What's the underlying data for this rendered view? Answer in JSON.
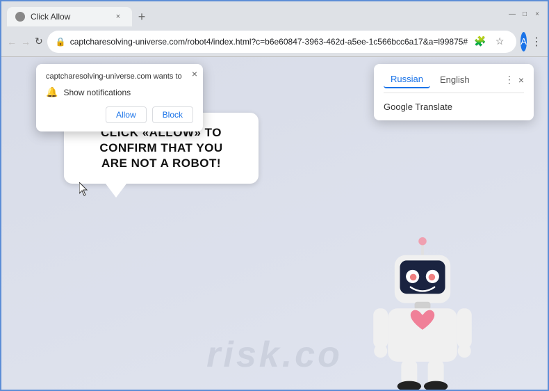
{
  "window": {
    "title": "Click Allow",
    "close_label": "×",
    "min_label": "—",
    "max_label": "□"
  },
  "tab": {
    "title": "Click Allow",
    "new_tab_icon": "+"
  },
  "address_bar": {
    "url": "captcharesolving-universe.com/robot4/index.html?c=b6e60847-3963-462d-a5ee-1c566bcc6a17&a=l99875#",
    "lock_icon": "🔒"
  },
  "nav": {
    "back_icon": "←",
    "forward_icon": "→",
    "refresh_icon": "↻",
    "star_icon": "☆",
    "options_icon": "⋮"
  },
  "notification_popup": {
    "site": "captcharesolving-universe.com wants to",
    "permission": "Show notifications",
    "allow_label": "Allow",
    "block_label": "Block",
    "close_icon": "×"
  },
  "translate_popup": {
    "tab_russian": "Russian",
    "tab_english": "English",
    "title": "Google Translate",
    "options_icon": "⋮",
    "close_icon": "×"
  },
  "speech_bubble": {
    "line1": "CLICK «ALLOW» TO CONFIRM THAT YOU",
    "line2": "ARE NOT A ROBOT!"
  },
  "watermark": {
    "text": "risk.co"
  },
  "icons": {
    "bell": "🔔",
    "lock": "🔒",
    "star": "☆",
    "profile": "A",
    "options": "⋮",
    "extensions": "🧩"
  }
}
